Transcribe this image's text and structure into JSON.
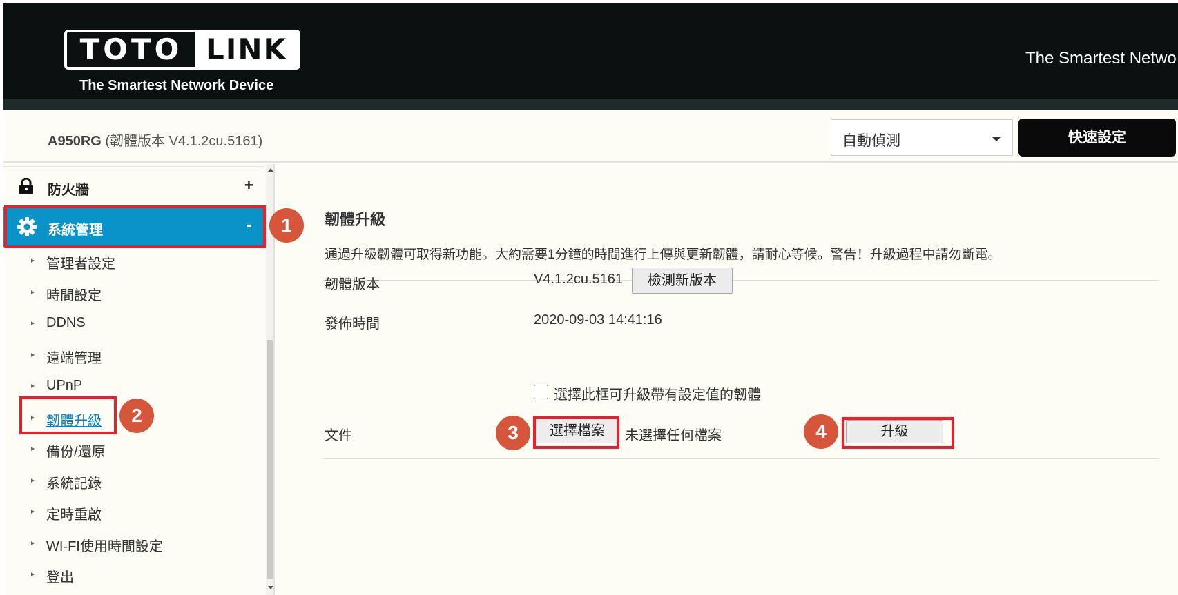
{
  "header": {
    "logo_left": "TOTO",
    "logo_right": "LINK",
    "logo_tagline": "The Smartest Network Device",
    "slogan": "The Smartest Netwo"
  },
  "topbar": {
    "model_name": "A950RG",
    "firmware_info": "(韌體版本 V4.1.2cu.5161)",
    "language_select": "自動偵測",
    "quick_setup_label": "快速設定"
  },
  "sidebar": {
    "firewall": {
      "label": "防火牆",
      "expand": "+"
    },
    "system": {
      "label": "系統管理",
      "collapse": "-"
    },
    "items": [
      {
        "label": "管理者設定"
      },
      {
        "label": "時間設定"
      },
      {
        "label": "DDNS"
      },
      {
        "label": "遠端管理"
      },
      {
        "label": "UPnP"
      },
      {
        "label": "韌體升級",
        "active": true
      },
      {
        "label": "備份/還原"
      },
      {
        "label": "系統記錄"
      },
      {
        "label": "定時重啟"
      },
      {
        "label": "WI-FI使用時間設定"
      },
      {
        "label": "登出"
      }
    ]
  },
  "main": {
    "title": "韌體升級",
    "description": "通過升級韌體可取得新功能。大約需要1分鐘的時間進行上傳與更新韌體，請耐心等候。警告！升級過程中請勿斷電。",
    "firmware_version_label": "韌體版本",
    "firmware_version_value": "V4.1.2cu.5161",
    "check_new_version_label": "檢測新版本",
    "release_time_label": "發佈時間",
    "release_time_value": "2020-09-03 14:41:16",
    "keep_settings_label": "選擇此框可升級帶有設定值的韌體",
    "file_label": "文件",
    "choose_file_label": "選擇檔案",
    "no_file_label": "未選擇任何檔案",
    "upgrade_label": "升級"
  },
  "annotations": {
    "badge_1": "1",
    "badge_2": "2",
    "badge_3": "3",
    "badge_4": "4",
    "highlight_color": "#e8202c",
    "badge_color": "#d5563a"
  },
  "colors": {
    "header_bg": "#0c1010",
    "accent_blue": "#0a93c8",
    "page_bg": "#fdfdf6"
  }
}
